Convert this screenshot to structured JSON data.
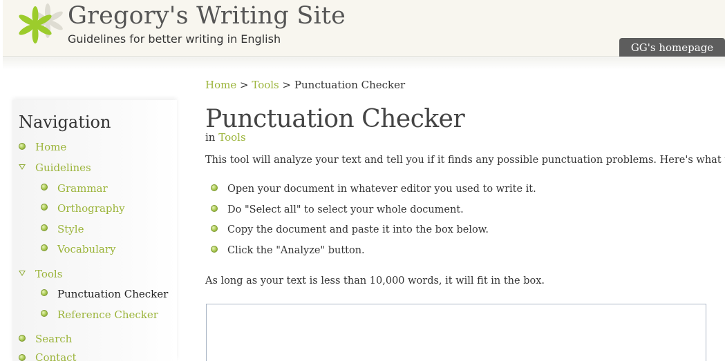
{
  "header": {
    "site_title": "Gregory's Writing Site",
    "subtitle": "Guidelines for better writing in English",
    "homepage_link": "GG's homepage",
    "logo_icon": "asterisk-flower-icon",
    "accent_color": "#9bb43a"
  },
  "breadcrumb": {
    "home": "Home",
    "sep1": ">",
    "tools": "Tools",
    "sep2": ">",
    "current": "Punctuation Checker"
  },
  "page": {
    "title": "Punctuation Checker",
    "category_prefix": "in",
    "category": "Tools",
    "intro": "This tool will analyze your text and tell you if it finds any possible punctuation problems. Here's what to do:",
    "steps": [
      "Open your document in whatever editor you used to write it.",
      "Do \"Select all\" to select your whole document.",
      "Copy the document and paste it into the box below.",
      "Click the \"Analyze\" button."
    ],
    "note": "As long as your text is less than 10,000 words, it will fit in the box.",
    "textbox_value": ""
  },
  "sidebar": {
    "title": "Navigation",
    "items": [
      {
        "label": "Home",
        "icon": "bullet-icon"
      },
      {
        "label": "Guidelines",
        "icon": "expanded-triangle-icon"
      },
      {
        "label": "Grammar",
        "icon": "bullet-icon"
      },
      {
        "label": "Orthography",
        "icon": "bullet-icon"
      },
      {
        "label": "Style",
        "icon": "bullet-icon"
      },
      {
        "label": "Vocabulary",
        "icon": "bullet-icon"
      },
      {
        "label": "Tools",
        "icon": "expanded-triangle-icon"
      },
      {
        "label": "Punctuation Checker",
        "icon": "bullet-icon"
      },
      {
        "label": "Reference Checker",
        "icon": "bullet-icon"
      },
      {
        "label": "Search",
        "icon": "bullet-icon"
      },
      {
        "label": "Contact",
        "icon": "bullet-icon"
      }
    ]
  }
}
